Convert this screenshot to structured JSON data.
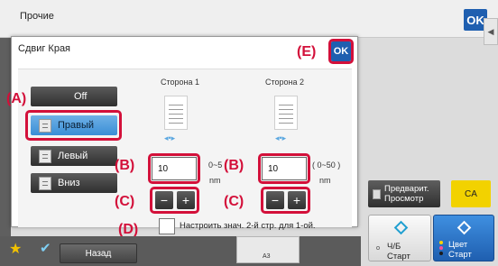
{
  "outer": {
    "title": "Прочие",
    "ok_label": "OK",
    "tab_glyph": "◀︎"
  },
  "dialog": {
    "title": "Сдвиг Края",
    "ok_label": "OK"
  },
  "options": [
    {
      "label": "Off"
    },
    {
      "label": "Правый",
      "selected": true
    },
    {
      "label": "Левый"
    },
    {
      "label": "Вниз"
    }
  ],
  "side1": {
    "label": "Сторона 1",
    "value": "10",
    "range": "0~5",
    "unit": "nm"
  },
  "side2": {
    "label": "Сторона 2",
    "value": "10",
    "range": "( 0~50 )",
    "unit": "nm"
  },
  "stepper": {
    "minus": "−",
    "plus": "+"
  },
  "checkbox_label": "Настроить знач. 2-й стр. для 1-ой.",
  "callouts": {
    "a": "(A)",
    "b": "(B)",
    "c": "(C)",
    "d": "(D)",
    "e": "(E)"
  },
  "preview_label_1": "Предварит.",
  "preview_label_2": "Просмотр",
  "ca_label": "CA",
  "bw": {
    "line1": "Ч/Б",
    "line2": "Старт"
  },
  "color": {
    "line1": "Цвет",
    "line2": "Старт"
  },
  "bottom": {
    "back_label": "Назад",
    "paper_label": "A3"
  },
  "colors": {
    "accent_blue": "#1f5fb0",
    "callout_red": "#d3103a",
    "selected_blue": "#4a9ae0",
    "ca_yellow": "#f2d200"
  }
}
